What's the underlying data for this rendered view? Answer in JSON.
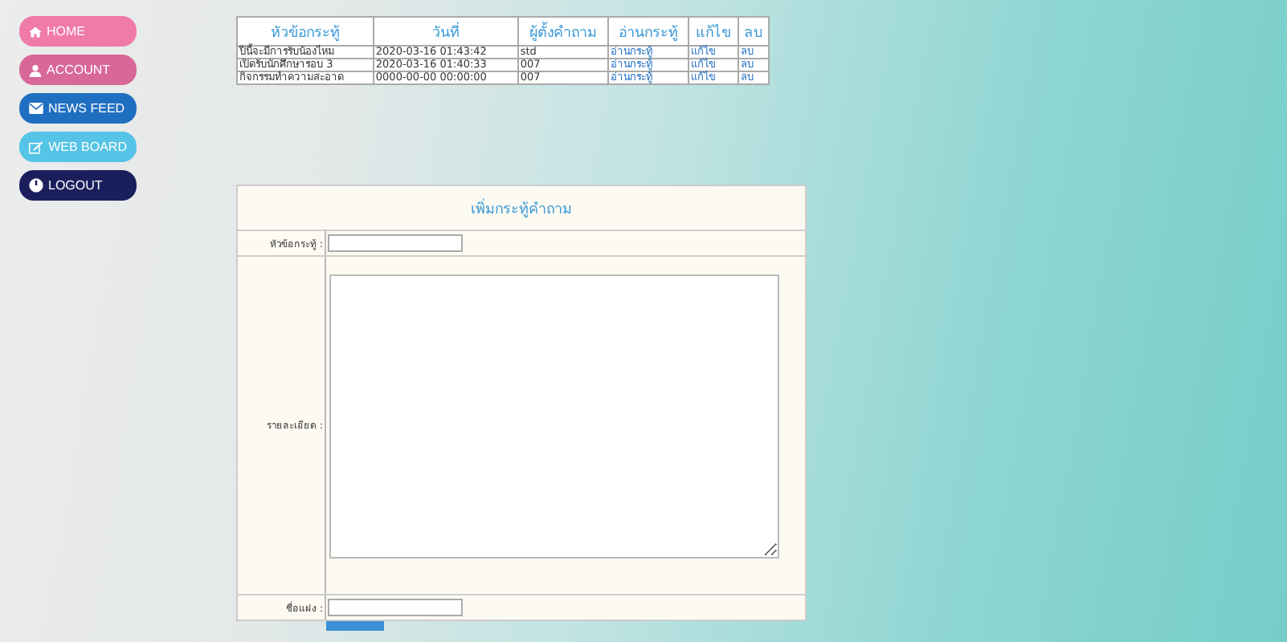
{
  "nav": [
    {
      "label": "HOME",
      "color": "#f07aa8"
    },
    {
      "label": "ACCOUNT",
      "color": "#d8679a"
    },
    {
      "label": "NEWS FEED",
      "color": "#1f6fc0"
    },
    {
      "label": "WEB BOARD",
      "color": "#55c4e6"
    },
    {
      "label": "LOGOUT",
      "color": "#1a1f5c"
    }
  ],
  "table": {
    "columns": [
      "หัวข้อกระทู้",
      "วันที่",
      "ผู้ตั้งคำถาม",
      "อ่านกระทู้",
      "แก้ไข",
      "ลบ"
    ],
    "rows": [
      {
        "title": "ปีนี้จะมีการรับน้องไหม",
        "date": "2020-03-16 01:43:42",
        "author": "std",
        "read": "อ่านกระทู้",
        "edit": "แก้ไข",
        "delete": "ลบ"
      },
      {
        "title": "เปิดรับนักศึกษารอบ 3",
        "date": "2020-03-16 01:40:33",
        "author": "007",
        "read": "อ่านกระทู้",
        "edit": "แก้ไข",
        "delete": "ลบ"
      },
      {
        "title": "กิจกรรมทำความสะอาด",
        "date": "0000-00-00 00:00:00",
        "author": "007",
        "read": "อ่านกระทู้",
        "edit": "แก้ไข",
        "delete": "ลบ"
      }
    ]
  },
  "form": {
    "title": "เพิ่มกระทู้คำถาม",
    "fields": [
      {
        "label": "หัวข้อกระทู้ :",
        "kind": "text"
      },
      {
        "label": "รายละเอียด :",
        "kind": "textarea"
      },
      {
        "label": "ชื่อแฝง :",
        "kind": "text"
      }
    ]
  }
}
